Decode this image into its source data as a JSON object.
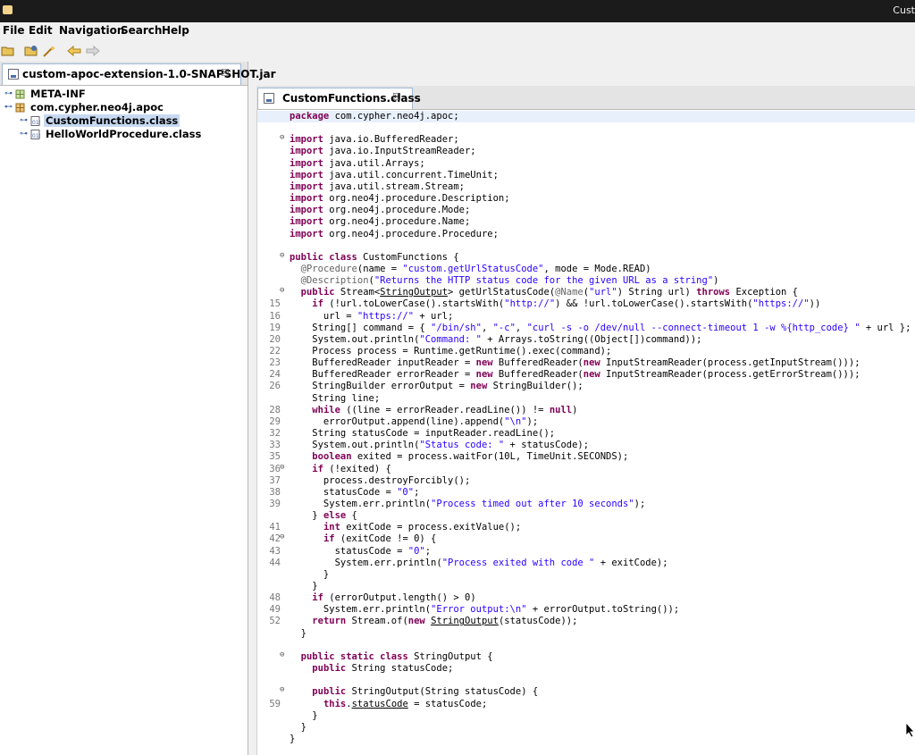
{
  "window": {
    "title": "Cust"
  },
  "menu": [
    "File",
    "Edit",
    "Navigation",
    "Search",
    "Help"
  ],
  "toolbar": [
    "open-icon",
    "open-type-icon",
    "wand-icon",
    "back-icon",
    "forward-icon"
  ],
  "left_tab": {
    "label": "custom-apoc-extension-1.0-SNAPSHOT.jar",
    "close": "☒"
  },
  "tree": [
    {
      "label": "META-INF",
      "level": 0
    },
    {
      "label": "com.cypher.neo4j.apoc",
      "level": 0
    },
    {
      "label": "CustomFunctions.class",
      "level": 1,
      "selected": true
    },
    {
      "label": "HelloWorldProcedure.class",
      "level": 1
    }
  ],
  "right_tab": {
    "label": "CustomFunctions.class",
    "close": "☒"
  },
  "code": [
    {
      "ln": "",
      "fold": "",
      "t": [
        [
          "k",
          "package"
        ],
        [
          "p",
          " com.cypher.neo4j.apoc;"
        ]
      ]
    },
    {
      "ln": "",
      "fold": "",
      "t": []
    },
    {
      "ln": "",
      "fold": "⊖",
      "t": [
        [
          "k",
          "import"
        ],
        [
          "p",
          " java.io.BufferedReader;"
        ]
      ]
    },
    {
      "ln": "",
      "fold": "",
      "t": [
        [
          "k",
          "import"
        ],
        [
          "p",
          " java.io.InputStreamReader;"
        ]
      ]
    },
    {
      "ln": "",
      "fold": "",
      "t": [
        [
          "k",
          "import"
        ],
        [
          "p",
          " java.util.Arrays;"
        ]
      ]
    },
    {
      "ln": "",
      "fold": "",
      "t": [
        [
          "k",
          "import"
        ],
        [
          "p",
          " java.util.concurrent.TimeUnit;"
        ]
      ]
    },
    {
      "ln": "",
      "fold": "",
      "t": [
        [
          "k",
          "import"
        ],
        [
          "p",
          " java.util.stream.Stream;"
        ]
      ]
    },
    {
      "ln": "",
      "fold": "",
      "t": [
        [
          "k",
          "import"
        ],
        [
          "p",
          " org.neo4j.procedure.Description;"
        ]
      ]
    },
    {
      "ln": "",
      "fold": "",
      "t": [
        [
          "k",
          "import"
        ],
        [
          "p",
          " org.neo4j.procedure.Mode;"
        ]
      ]
    },
    {
      "ln": "",
      "fold": "",
      "t": [
        [
          "k",
          "import"
        ],
        [
          "p",
          " org.neo4j.procedure.Name;"
        ]
      ]
    },
    {
      "ln": "",
      "fold": "",
      "t": [
        [
          "k",
          "import"
        ],
        [
          "p",
          " org.neo4j.procedure.Procedure;"
        ]
      ]
    },
    {
      "ln": "",
      "fold": "",
      "t": []
    },
    {
      "ln": "",
      "fold": "⊖",
      "t": [
        [
          "k",
          "public class"
        ],
        [
          "p",
          " CustomFunctions {"
        ]
      ]
    },
    {
      "ln": "",
      "fold": "",
      "t": [
        [
          "p",
          "  "
        ],
        [
          "a",
          "@Procedure"
        ],
        [
          "p",
          "(name = "
        ],
        [
          "s",
          "\"custom.getUrlStatusCode\""
        ],
        [
          "p",
          ", mode = Mode.READ)"
        ]
      ]
    },
    {
      "ln": "",
      "fold": "",
      "t": [
        [
          "p",
          "  "
        ],
        [
          "a",
          "@Description"
        ],
        [
          "p",
          "("
        ],
        [
          "s",
          "\"Returns the HTTP status code for the given URL as a string\""
        ],
        [
          "p",
          ")"
        ]
      ]
    },
    {
      "ln": "",
      "fold": "⊖",
      "t": [
        [
          "p",
          "  "
        ],
        [
          "k",
          "public"
        ],
        [
          "p",
          " Stream<"
        ],
        [
          "u",
          "StringOutput"
        ],
        [
          "p",
          "> getUrlStatusCode("
        ],
        [
          "a",
          "@Name"
        ],
        [
          "p",
          "("
        ],
        [
          "s",
          "\"url\""
        ],
        [
          "p",
          ") String url) "
        ],
        [
          "k",
          "throws"
        ],
        [
          "p",
          " Exception {"
        ]
      ]
    },
    {
      "ln": "15",
      "fold": "",
      "t": [
        [
          "p",
          "    "
        ],
        [
          "k",
          "if"
        ],
        [
          "p",
          " (!url.toLowerCase().startsWith("
        ],
        [
          "s",
          "\"http://\""
        ],
        [
          "p",
          ") && !url.toLowerCase().startsWith("
        ],
        [
          "s",
          "\"https://\""
        ],
        [
          "p",
          "))"
        ]
      ]
    },
    {
      "ln": "16",
      "fold": "",
      "t": [
        [
          "p",
          "      url = "
        ],
        [
          "s",
          "\"https://\""
        ],
        [
          "p",
          " + url;"
        ]
      ]
    },
    {
      "ln": "19",
      "fold": "",
      "t": [
        [
          "p",
          "    String[] command = { "
        ],
        [
          "s",
          "\"/bin/sh\""
        ],
        [
          "p",
          ", "
        ],
        [
          "s",
          "\"-c\""
        ],
        [
          "p",
          ", "
        ],
        [
          "s",
          "\"curl -s -o /dev/null --connect-timeout 1 -w %{http_code} \""
        ],
        [
          "p",
          " + url };"
        ]
      ]
    },
    {
      "ln": "20",
      "fold": "",
      "t": [
        [
          "p",
          "    System.out.println("
        ],
        [
          "s",
          "\"Command: \""
        ],
        [
          "p",
          " + Arrays.toString((Object[])command));"
        ]
      ]
    },
    {
      "ln": "22",
      "fold": "",
      "t": [
        [
          "p",
          "    Process process = Runtime.getRuntime().exec(command);"
        ]
      ]
    },
    {
      "ln": "23",
      "fold": "",
      "t": [
        [
          "p",
          "    BufferedReader inputReader = "
        ],
        [
          "k",
          "new"
        ],
        [
          "p",
          " BufferedReader("
        ],
        [
          "k",
          "new"
        ],
        [
          "p",
          " InputStreamReader(process.getInputStream()));"
        ]
      ]
    },
    {
      "ln": "24",
      "fold": "",
      "t": [
        [
          "p",
          "    BufferedReader errorReader = "
        ],
        [
          "k",
          "new"
        ],
        [
          "p",
          " BufferedReader("
        ],
        [
          "k",
          "new"
        ],
        [
          "p",
          " InputStreamReader(process.getErrorStream()));"
        ]
      ]
    },
    {
      "ln": "26",
      "fold": "",
      "t": [
        [
          "p",
          "    StringBuilder errorOutput = "
        ],
        [
          "k",
          "new"
        ],
        [
          "p",
          " StringBuilder();"
        ]
      ]
    },
    {
      "ln": "",
      "fold": "",
      "t": [
        [
          "p",
          "    String line;"
        ]
      ]
    },
    {
      "ln": "28",
      "fold": "",
      "t": [
        [
          "p",
          "    "
        ],
        [
          "k",
          "while"
        ],
        [
          "p",
          " ((line = errorReader.readLine()) != "
        ],
        [
          "k",
          "null"
        ],
        [
          "p",
          ")"
        ]
      ]
    },
    {
      "ln": "29",
      "fold": "",
      "t": [
        [
          "p",
          "      errorOutput.append(line).append("
        ],
        [
          "s",
          "\"\\n\""
        ],
        [
          "p",
          ");"
        ]
      ]
    },
    {
      "ln": "32",
      "fold": "",
      "t": [
        [
          "p",
          "    String statusCode = inputReader.readLine();"
        ]
      ]
    },
    {
      "ln": "33",
      "fold": "",
      "t": [
        [
          "p",
          "    System.out.println("
        ],
        [
          "s",
          "\"Status code: \""
        ],
        [
          "p",
          " + statusCode);"
        ]
      ]
    },
    {
      "ln": "35",
      "fold": "",
      "t": [
        [
          "p",
          "    "
        ],
        [
          "k",
          "boolean"
        ],
        [
          "p",
          " exited = process.waitFor(10L, TimeUnit.SECONDS);"
        ]
      ]
    },
    {
      "ln": "36",
      "fold": "⊖",
      "t": [
        [
          "p",
          "    "
        ],
        [
          "k",
          "if"
        ],
        [
          "p",
          " (!exited) {"
        ]
      ]
    },
    {
      "ln": "37",
      "fold": "",
      "t": [
        [
          "p",
          "      process.destroyForcibly();"
        ]
      ]
    },
    {
      "ln": "38",
      "fold": "",
      "t": [
        [
          "p",
          "      statusCode = "
        ],
        [
          "s",
          "\"0\""
        ],
        [
          "p",
          ";"
        ]
      ]
    },
    {
      "ln": "39",
      "fold": "",
      "t": [
        [
          "p",
          "      System.err.println("
        ],
        [
          "s",
          "\"Process timed out after 10 seconds\""
        ],
        [
          "p",
          ");"
        ]
      ]
    },
    {
      "ln": "",
      "fold": "",
      "t": [
        [
          "p",
          "    } "
        ],
        [
          "k",
          "else"
        ],
        [
          "p",
          " {"
        ]
      ]
    },
    {
      "ln": "41",
      "fold": "",
      "t": [
        [
          "p",
          "      "
        ],
        [
          "k",
          "int"
        ],
        [
          "p",
          " exitCode = process.exitValue();"
        ]
      ]
    },
    {
      "ln": "42",
      "fold": "⊖",
      "t": [
        [
          "p",
          "      "
        ],
        [
          "k",
          "if"
        ],
        [
          "p",
          " (exitCode != 0) {"
        ]
      ]
    },
    {
      "ln": "43",
      "fold": "",
      "t": [
        [
          "p",
          "        statusCode = "
        ],
        [
          "s",
          "\"0\""
        ],
        [
          "p",
          ";"
        ]
      ]
    },
    {
      "ln": "44",
      "fold": "",
      "t": [
        [
          "p",
          "        System.err.println("
        ],
        [
          "s",
          "\"Process exited with code \""
        ],
        [
          "p",
          " + exitCode);"
        ]
      ]
    },
    {
      "ln": "",
      "fold": "",
      "t": [
        [
          "p",
          "      }"
        ]
      ]
    },
    {
      "ln": "",
      "fold": "",
      "t": [
        [
          "p",
          "    }"
        ]
      ]
    },
    {
      "ln": "48",
      "fold": "",
      "t": [
        [
          "p",
          "    "
        ],
        [
          "k",
          "if"
        ],
        [
          "p",
          " (errorOutput.length() > 0)"
        ]
      ]
    },
    {
      "ln": "49",
      "fold": "",
      "t": [
        [
          "p",
          "      System.err.println("
        ],
        [
          "s",
          "\"Error output:\\n\""
        ],
        [
          "p",
          " + errorOutput.toString());"
        ]
      ]
    },
    {
      "ln": "52",
      "fold": "",
      "t": [
        [
          "p",
          "    "
        ],
        [
          "k",
          "return"
        ],
        [
          "p",
          " Stream.of("
        ],
        [
          "k",
          "new"
        ],
        [
          "p",
          " "
        ],
        [
          "u",
          "StringOutput"
        ],
        [
          "p",
          "(statusCode));"
        ]
      ]
    },
    {
      "ln": "",
      "fold": "",
      "t": [
        [
          "p",
          "  }"
        ]
      ]
    },
    {
      "ln": "",
      "fold": "",
      "t": []
    },
    {
      "ln": "",
      "fold": "⊖",
      "t": [
        [
          "p",
          "  "
        ],
        [
          "k",
          "public static class"
        ],
        [
          "p",
          " StringOutput {"
        ]
      ]
    },
    {
      "ln": "",
      "fold": "",
      "t": [
        [
          "p",
          "    "
        ],
        [
          "k",
          "public"
        ],
        [
          "p",
          " String statusCode;"
        ]
      ]
    },
    {
      "ln": "",
      "fold": "",
      "t": []
    },
    {
      "ln": "",
      "fold": "⊖",
      "t": [
        [
          "p",
          "    "
        ],
        [
          "k",
          "public"
        ],
        [
          "p",
          " StringOutput(String statusCode) {"
        ]
      ]
    },
    {
      "ln": "59",
      "fold": "",
      "t": [
        [
          "p",
          "      "
        ],
        [
          "k",
          "this"
        ],
        [
          "p",
          "."
        ],
        [
          "u",
          "statusCode"
        ],
        [
          "p",
          " = statusCode;"
        ]
      ]
    },
    {
      "ln": "",
      "fold": "",
      "t": [
        [
          "p",
          "    }"
        ]
      ]
    },
    {
      "ln": "",
      "fold": "",
      "t": [
        [
          "p",
          "  }"
        ]
      ]
    },
    {
      "ln": "",
      "fold": "",
      "t": [
        [
          "p",
          "}"
        ]
      ]
    }
  ]
}
